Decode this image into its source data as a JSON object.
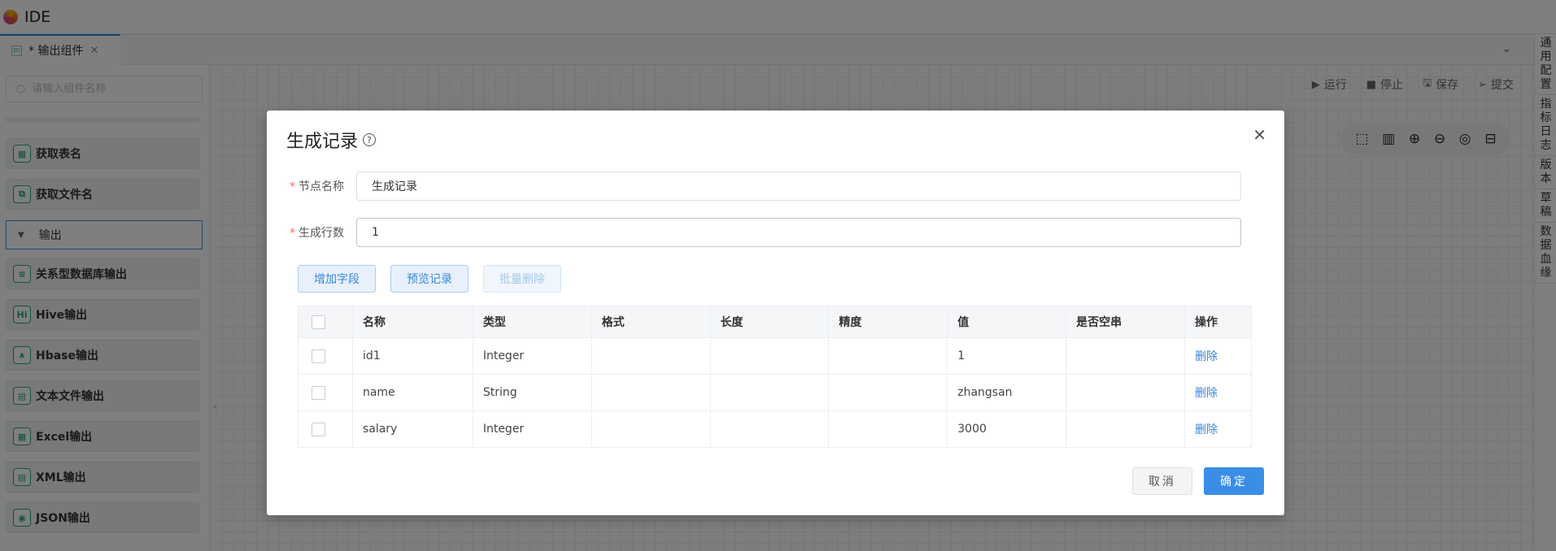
{
  "app": {
    "title": "IDE"
  },
  "tab": {
    "icon": "DI",
    "label": "* 输出组件",
    "close": "✕"
  },
  "search": {
    "placeholder": "请输入组件名称"
  },
  "components": [
    {
      "label": "获取表名",
      "icon": "▦",
      "name": "get-table-name"
    },
    {
      "label": "获取文件名",
      "icon": "⧉",
      "name": "get-file-name"
    }
  ],
  "group": {
    "label": "输出"
  },
  "output_components": [
    {
      "label": "关系型数据库输出",
      "icon": "≡",
      "name": "rdb-output"
    },
    {
      "label": "Hive输出",
      "icon": "Hi",
      "name": "hive-output"
    },
    {
      "label": "Hbase输出",
      "icon": "⩚",
      "name": "hbase-output"
    },
    {
      "label": "文本文件输出",
      "icon": "▤",
      "name": "text-file-output"
    },
    {
      "label": "Excel输出",
      "icon": "▦",
      "name": "excel-output"
    },
    {
      "label": "XML输出",
      "icon": "▤",
      "name": "xml-output"
    },
    {
      "label": "JSON输出",
      "icon": "◉",
      "name": "json-output"
    }
  ],
  "toolbar": {
    "run": "运行",
    "stop": "停止",
    "save": "保存",
    "submit": "提交"
  },
  "right_rail": [
    "通用配置",
    "指标日志",
    "版本",
    "草稿",
    "数据血缘"
  ],
  "modal": {
    "title": "生成记录",
    "node_name_label": "节点名称",
    "node_name_value": "生成记录",
    "rows_label": "生成行数",
    "rows_value": "1",
    "buttons": {
      "add_field": "增加字段",
      "preview": "预览记录",
      "batch_delete": "批量删除"
    },
    "columns": [
      "名称",
      "类型",
      "格式",
      "长度",
      "精度",
      "值",
      "是否空串",
      "操作"
    ],
    "rows": [
      {
        "name": "id1",
        "type": "Integer",
        "format": "",
        "length": "",
        "precision": "",
        "value": "1",
        "empty": "",
        "action": "删除"
      },
      {
        "name": "name",
        "type": "String",
        "format": "",
        "length": "",
        "precision": "",
        "value": "zhangsan",
        "empty": "",
        "action": "删除"
      },
      {
        "name": "salary",
        "type": "Integer",
        "format": "",
        "length": "",
        "precision": "",
        "value": "3000",
        "empty": "",
        "action": "删除"
      }
    ],
    "cancel": "取消",
    "ok": "确定"
  }
}
